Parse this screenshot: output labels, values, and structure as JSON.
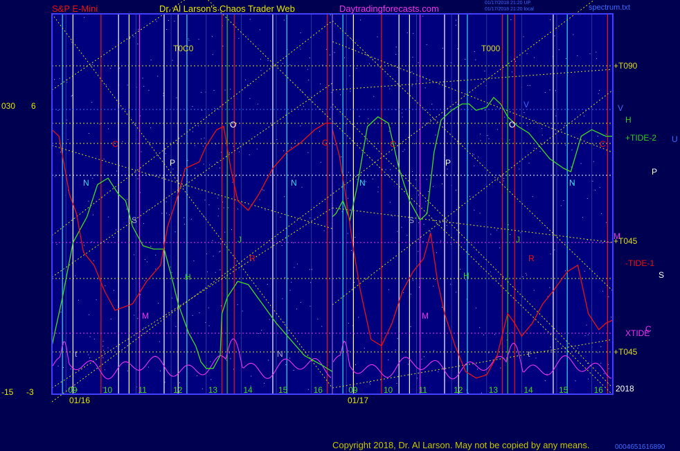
{
  "header": {
    "instrument": "S&P E-Mini",
    "site_title": "Dr. Al Larson's Chaos Trader Web",
    "site_url": "Daytradingforecasts.com",
    "timestamp_1": "01/17/2018 21:20 UP",
    "timestamp_2": "01/17/2018 21:20 local",
    "file_name": "spectrum.txt"
  },
  "left_axis": {
    "outer_top": "030",
    "inner_top": "6",
    "outer_bottom": "-15",
    "inner_bottom": "-3"
  },
  "footer": {
    "copyright": "Copyright 2018, Dr. Al Larson. May not be copied by any means.",
    "code": "0004651616890"
  },
  "colors": {
    "background": "#000050",
    "plot_bg": "#00007e",
    "frame": "#4040ff",
    "price_green": "#44dd22",
    "price_red": "#ee1111",
    "magenta": "#ee33ee",
    "yellow": "#dddd22",
    "cyan": "#33ddee",
    "white": "#ffffff"
  },
  "chart_data": {
    "type": "line",
    "title": "S&P E-Mini",
    "panels": [
      {
        "date": "01/16",
        "x_ticks": [
          "09",
          "10",
          "11",
          "12",
          "13",
          "14",
          "15",
          "16"
        ],
        "x_range": [
          8.2,
          16.2
        ],
        "hour_lines": [
          8.6,
          9.6,
          10.6,
          11.6,
          12.6,
          13.6,
          14.6,
          15.6
        ],
        "vlines": [
          {
            "h": 8.2,
            "c": "red"
          },
          {
            "h": 8.5,
            "c": "cyan"
          },
          {
            "h": 8.8,
            "c": "white"
          },
          {
            "h": 9.6,
            "c": "red"
          },
          {
            "h": 10.1,
            "c": "white"
          },
          {
            "h": 10.4,
            "c": "white"
          },
          {
            "h": 10.7,
            "c": "magenta"
          },
          {
            "h": 11.4,
            "c": "white"
          },
          {
            "h": 11.8,
            "c": "white"
          },
          {
            "h": 12.05,
            "c": "cyan"
          },
          {
            "h": 13.05,
            "c": "red"
          },
          {
            "h": 13.2,
            "c": "green"
          },
          {
            "h": 13.4,
            "c": "red"
          },
          {
            "h": 14.5,
            "c": "white"
          },
          {
            "h": 14.9,
            "c": "cyan"
          },
          {
            "h": 16.05,
            "c": "red"
          }
        ],
        "green_line": [
          [
            8.2,
            -1.5
          ],
          [
            8.5,
            0.0
          ],
          [
            8.8,
            1.7
          ],
          [
            9.2,
            2.5
          ],
          [
            9.5,
            3.5
          ],
          [
            9.8,
            3.7
          ],
          [
            10.1,
            3.2
          ],
          [
            10.3,
            3.0
          ],
          [
            10.5,
            2.2
          ],
          [
            10.8,
            1.6
          ],
          [
            11.1,
            1.5
          ],
          [
            11.4,
            1.5
          ],
          [
            11.6,
            0.7
          ],
          [
            11.8,
            -0.2
          ],
          [
            12.1,
            -1.1
          ],
          [
            12.3,
            -1.5
          ],
          [
            12.45,
            -2.0
          ],
          [
            12.6,
            -2.2
          ],
          [
            12.8,
            -2.2
          ],
          [
            13.0,
            -1.8
          ],
          [
            13.05,
            -0.5
          ],
          [
            13.2,
            0.0
          ],
          [
            13.5,
            0.5
          ],
          [
            13.8,
            0.4
          ],
          [
            14.2,
            -0.2
          ],
          [
            14.6,
            -0.8
          ],
          [
            15.0,
            -1.3
          ],
          [
            15.4,
            -1.8
          ],
          [
            15.9,
            -2.1
          ],
          [
            16.2,
            -2.3
          ]
        ],
        "red_line": [
          [
            8.2,
            5.2
          ],
          [
            8.4,
            5.0
          ],
          [
            8.7,
            3.2
          ],
          [
            8.9,
            2.6
          ],
          [
            9.1,
            1.4
          ],
          [
            9.4,
            1.0
          ],
          [
            9.7,
            0.2
          ],
          [
            10.0,
            -0.4
          ],
          [
            10.5,
            -0.2
          ],
          [
            10.9,
            0.5
          ],
          [
            11.3,
            1.0
          ],
          [
            11.5,
            2.2
          ],
          [
            11.8,
            3.2
          ],
          [
            12.0,
            4.0
          ],
          [
            12.4,
            4.2
          ],
          [
            12.6,
            4.7
          ],
          [
            12.9,
            5.2
          ],
          [
            13.1,
            5.3
          ],
          [
            13.3,
            4.0
          ],
          [
            13.5,
            3.0
          ],
          [
            13.8,
            2.7
          ],
          [
            14.1,
            3.2
          ],
          [
            14.5,
            4.0
          ],
          [
            14.9,
            4.5
          ],
          [
            15.3,
            4.8
          ],
          [
            15.7,
            5.2
          ],
          [
            16.0,
            5.4
          ],
          [
            16.2,
            5.4
          ]
        ],
        "labels": [
          "N",
          "C",
          "S",
          "M",
          "t",
          "H",
          "P",
          "O",
          "J",
          "R",
          "N",
          "C",
          "T0C0"
        ]
      },
      {
        "date": "01/17",
        "x_ticks": [
          "09",
          "10",
          "11",
          "12",
          "13",
          "14",
          "15",
          "16"
        ],
        "x_range": [
          8.2,
          16.2
        ],
        "hour_lines": [
          8.6,
          9.6,
          10.6,
          11.6,
          12.6,
          13.6,
          14.6,
          15.6
        ],
        "vlines": [
          {
            "h": 8.2,
            "c": "red"
          },
          {
            "h": 8.5,
            "c": "cyan"
          },
          {
            "h": 8.8,
            "c": "white"
          },
          {
            "h": 9.6,
            "c": "red"
          },
          {
            "h": 10.1,
            "c": "white"
          },
          {
            "h": 10.4,
            "c": "white"
          },
          {
            "h": 10.7,
            "c": "magenta"
          },
          {
            "h": 11.4,
            "c": "white"
          },
          {
            "h": 11.8,
            "c": "white"
          },
          {
            "h": 12.05,
            "c": "cyan"
          },
          {
            "h": 13.05,
            "c": "red"
          },
          {
            "h": 13.2,
            "c": "green"
          },
          {
            "h": 13.4,
            "c": "red"
          },
          {
            "h": 14.5,
            "c": "white"
          },
          {
            "h": 14.9,
            "c": "cyan"
          },
          {
            "h": 16.05,
            "c": "red"
          }
        ],
        "green_line": [
          [
            8.2,
            2.5
          ],
          [
            8.3,
            2.6
          ],
          [
            8.5,
            3.0
          ],
          [
            8.7,
            2.4
          ],
          [
            8.9,
            3.4
          ],
          [
            9.2,
            5.3
          ],
          [
            9.5,
            5.6
          ],
          [
            9.8,
            5.4
          ],
          [
            10.1,
            4.0
          ],
          [
            10.4,
            3.0
          ],
          [
            10.7,
            2.4
          ],
          [
            10.9,
            2.6
          ],
          [
            11.1,
            4.5
          ],
          [
            11.3,
            5.5
          ],
          [
            11.6,
            5.8
          ],
          [
            11.9,
            6.0
          ],
          [
            12.1,
            6.0
          ],
          [
            12.3,
            5.8
          ],
          [
            12.6,
            5.9
          ],
          [
            12.8,
            6.2
          ],
          [
            13.0,
            6.0
          ],
          [
            13.2,
            5.6
          ],
          [
            13.5,
            5.3
          ],
          [
            13.8,
            5.1
          ],
          [
            14.1,
            4.7
          ],
          [
            14.4,
            4.3
          ],
          [
            14.8,
            4.0
          ],
          [
            15.0,
            3.9
          ],
          [
            15.3,
            5.0
          ],
          [
            15.6,
            5.2
          ],
          [
            16.0,
            5.0
          ],
          [
            16.2,
            5.0
          ]
        ],
        "red_line": [
          [
            8.2,
            5.2
          ],
          [
            8.4,
            4.4
          ],
          [
            8.6,
            3.0
          ],
          [
            8.8,
            1.5
          ],
          [
            9.0,
            0.2
          ],
          [
            9.3,
            -1.3
          ],
          [
            9.6,
            -1.5
          ],
          [
            9.9,
            -0.8
          ],
          [
            10.2,
            0.2
          ],
          [
            10.5,
            0.8
          ],
          [
            10.8,
            1.2
          ],
          [
            11.0,
            2.0
          ],
          [
            11.2,
            0.5
          ],
          [
            11.4,
            -0.5
          ],
          [
            11.7,
            -1.5
          ],
          [
            12.0,
            -2.3
          ],
          [
            12.3,
            -2.5
          ],
          [
            12.6,
            -2.4
          ],
          [
            12.9,
            -1.8
          ],
          [
            13.2,
            -0.5
          ],
          [
            13.4,
            -0.8
          ],
          [
            13.6,
            -1.2
          ],
          [
            13.9,
            -0.8
          ],
          [
            14.2,
            -0.2
          ],
          [
            14.5,
            0.2
          ],
          [
            14.9,
            0.8
          ],
          [
            15.2,
            1.0
          ],
          [
            15.5,
            -0.5
          ],
          [
            15.8,
            -1.0
          ],
          [
            16.0,
            -0.8
          ],
          [
            16.2,
            -0.7
          ]
        ],
        "labels": [
          "N",
          "C",
          "S",
          "M",
          "P",
          "J",
          "H",
          "V",
          "O",
          "N",
          "R",
          "t",
          "N",
          "C",
          "T000"
        ]
      }
    ],
    "right_labels": [
      {
        "text": "+T090",
        "color": "yellow"
      },
      {
        "text": "V",
        "color": "blue"
      },
      {
        "text": "H",
        "color": "green"
      },
      {
        "text": "+TIDE-2",
        "color": "green"
      },
      {
        "text": "U",
        "color": "blue"
      },
      {
        "text": "P",
        "color": "white"
      },
      {
        "text": "M",
        "color": "magenta"
      },
      {
        "text": "+T045",
        "color": "yellow"
      },
      {
        "text": "-TIDE-1",
        "color": "red"
      },
      {
        "text": "S",
        "color": "white"
      },
      {
        "text": "C",
        "color": "magenta"
      },
      {
        "text": "XTIDE",
        "color": "magenta"
      },
      {
        "text": "+T045",
        "color": "yellow"
      },
      {
        "text": "2018",
        "color": "white"
      }
    ]
  }
}
